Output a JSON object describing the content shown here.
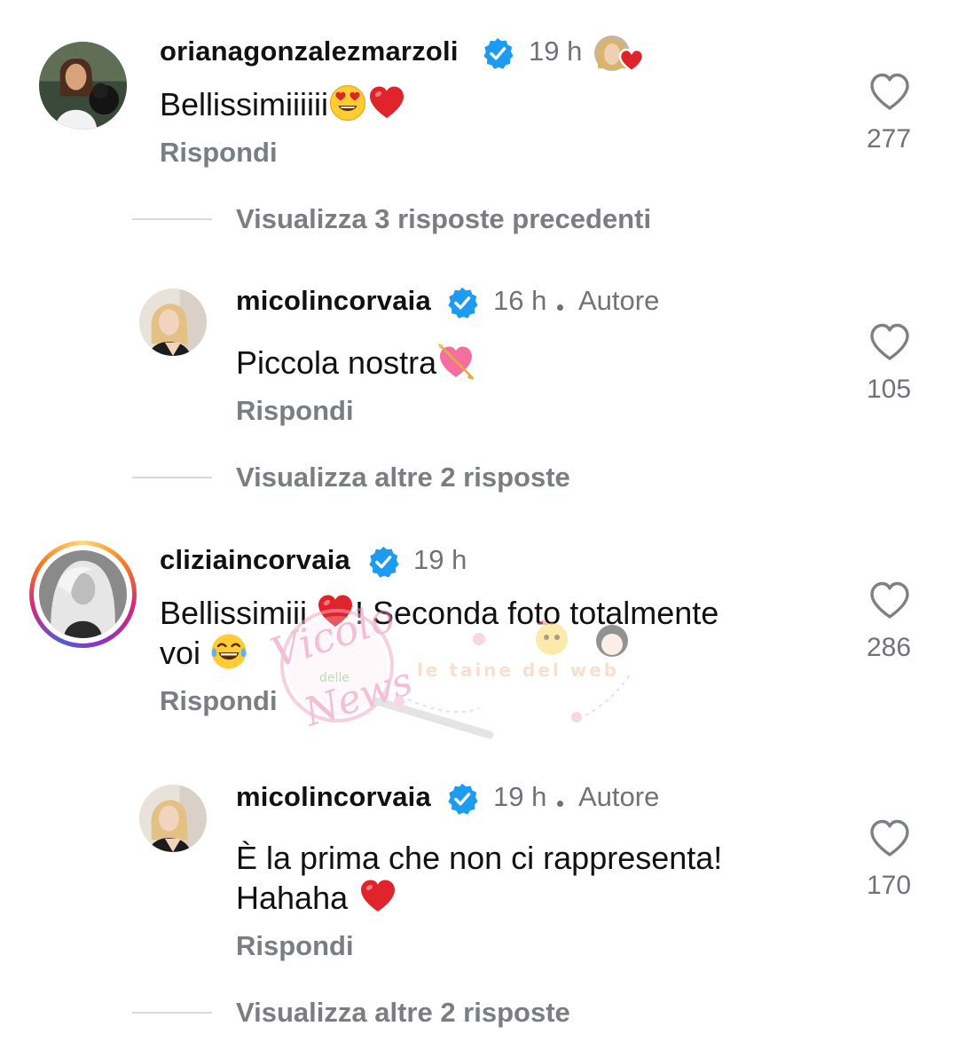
{
  "colors": {
    "text_primary": "#111111",
    "text_secondary": "#6f7378",
    "link_gray": "#7a7e83",
    "verified_blue": "#1d9bf0",
    "heart_red": "#e0242b",
    "divider": "#d7d9dc"
  },
  "comments": [
    {
      "username": "orianagonzalezmarzoli",
      "verified": true,
      "time": "19 h",
      "author_badge": "",
      "liked_by_author": true,
      "text_line1": "Bellissimiiiiii",
      "text_line1_emoji": [
        "heart-eyes-emoji",
        "red-heart-emoji"
      ],
      "reply_label": "Rispondi",
      "likes": "277",
      "view_replies": "Visualizza 3 risposte precedenti"
    },
    {
      "username": "micolincorvaia",
      "verified": true,
      "time": "16 h",
      "author_badge": "Autore",
      "text_line1": "Piccola nostra",
      "text_line1_emoji": [
        "heart-arrow-emoji"
      ],
      "reply_label": "Rispondi",
      "likes": "105",
      "view_replies": "Visualizza altre 2 risposte"
    },
    {
      "username": "cliziaincorvaia",
      "verified": true,
      "time": "19 h",
      "author_badge": "",
      "has_story_ring": true,
      "text_line1_a": "Bellissimiii",
      "text_line1_emoji": [
        "red-heart-emoji"
      ],
      "text_line1_b": "! Seconda foto totalmente",
      "text_line2": "voi",
      "text_line2_emoji": [
        "tears-of-joy-emoji"
      ],
      "reply_label": "Rispondi",
      "likes": "286"
    },
    {
      "username": "micolincorvaia",
      "verified": true,
      "time": "19 h",
      "author_badge": "Autore",
      "text_line1": "È la prima che non ci rappresenta!",
      "text_line2": "Hahaha",
      "text_line2_emoji": [
        "red-heart-emoji"
      ],
      "reply_label": "Rispondi",
      "likes": "170",
      "view_replies": "Visualizza altre 2 risposte"
    }
  ],
  "watermark": {
    "brand_script": "Vicolo",
    "brand_small": "delle",
    "brand_script2": "News",
    "tagline": "le taine del web"
  }
}
